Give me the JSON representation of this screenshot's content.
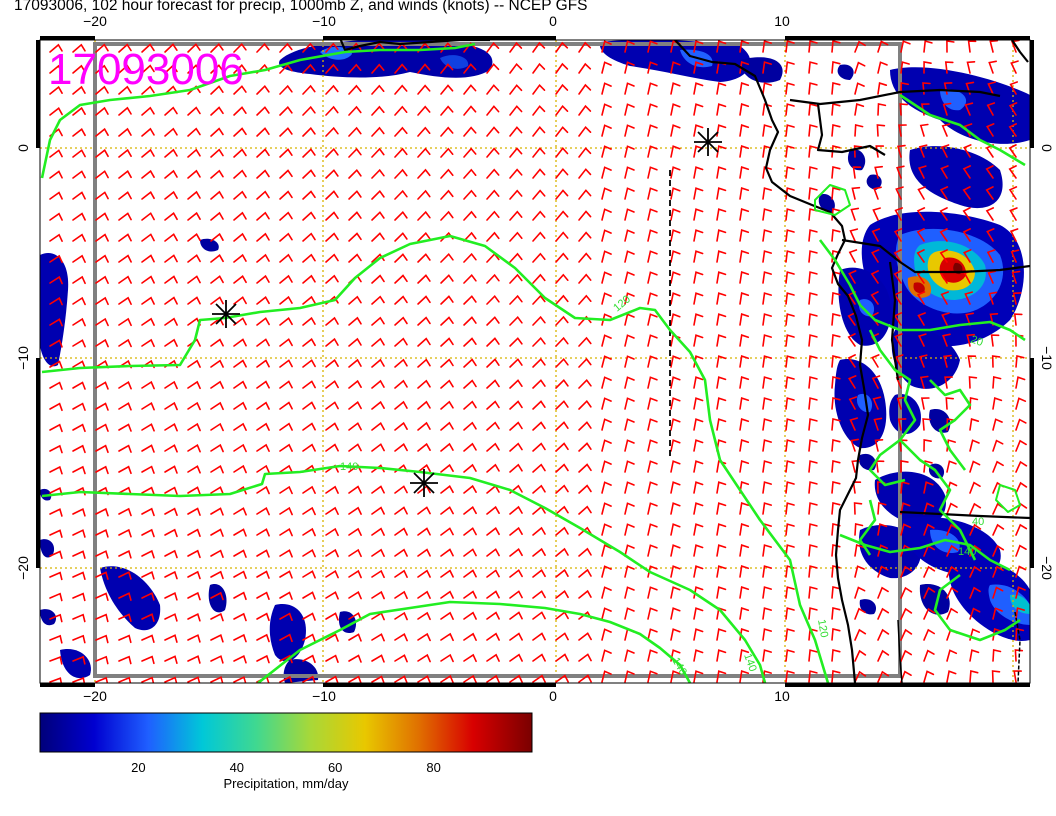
{
  "title": "17093006, 102 hour forecast for precip, 1000mb Z, and winds (knots) -- NCEP GFS",
  "stamp": "17093006",
  "x_ticks_top": [
    {
      "label": "−20",
      "lon": -20
    },
    {
      "label": "−10",
      "lon": -10
    },
    {
      "label": "0",
      "lon": 0
    },
    {
      "label": "10",
      "lon": 10
    }
  ],
  "x_ticks_bottom": [
    {
      "label": "−20",
      "lon": -20
    },
    {
      "label": "−10",
      "lon": -10
    },
    {
      "label": "0",
      "lon": 0
    },
    {
      "label": "10",
      "lon": 10
    }
  ],
  "y_ticks_left": [
    {
      "label": "0",
      "lat": 0
    },
    {
      "label": "−10",
      "lat": -10
    },
    {
      "label": "−20",
      "lat": -20
    }
  ],
  "y_ticks_right": [
    {
      "label": "0",
      "lat": 0
    },
    {
      "label": "−10",
      "lat": -10
    },
    {
      "label": "−20",
      "lat": -20
    }
  ],
  "contour_labels": [
    "120",
    "140",
    "140",
    "140",
    "140",
    "120",
    "20",
    "40"
  ],
  "colorbar": {
    "label": "Precipitation, mm/day",
    "ticks": [
      {
        "label": "20",
        "value": 20
      },
      {
        "label": "40",
        "value": 40
      },
      {
        "label": "60",
        "value": 60
      },
      {
        "label": "80",
        "value": 80
      }
    ],
    "range": [
      0,
      100
    ],
    "stops": [
      "#00007a",
      "#0000d0",
      "#1f5fff",
      "#00c8d8",
      "#40d890",
      "#a8d838",
      "#e8c800",
      "#e07000",
      "#d80000",
      "#7a0000"
    ]
  },
  "colors": {
    "contour": "#22ee22",
    "wind_barb": "#ff0000",
    "grid": "#d8b400",
    "coast": "#000000",
    "stamp": "#ff00ff",
    "frame": "#808080"
  },
  "map": {
    "lon_range": [
      -22.5,
      20
    ],
    "lat_range": [
      -25.5,
      5
    ],
    "grid_lons": [
      -20,
      -10,
      0,
      10
    ],
    "grid_lats": [
      0,
      -10,
      -20
    ],
    "markers": [
      "asterisk",
      "asterisk",
      "asterisk",
      "asterisk"
    ]
  }
}
